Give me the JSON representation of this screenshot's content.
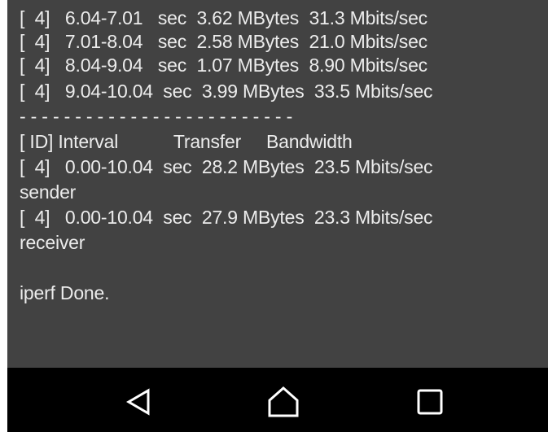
{
  "terminal": {
    "lines": [
      "[  4]   6.04-7.01   sec  3.62 MBytes  31.3 Mbits/sec",
      "[  4]   7.01-8.04   sec  2.58 MBytes  21.0 Mbits/sec",
      "[  4]   8.04-9.04   sec  1.07 MBytes  8.90 Mbits/sec",
      "[  4]   9.04-10.04  sec  3.99 MBytes  33.5 Mbits/sec",
      "- - - - - - - - - - - - - - - - - - - - - - - - -",
      "[ ID] Interval           Transfer     Bandwidth",
      "[  4]   0.00-10.04  sec  28.2 MBytes  23.5 Mbits/sec",
      "sender",
      "[  4]   0.00-10.04  sec  27.9 MBytes  23.3 Mbits/sec",
      "receiver",
      "",
      "iperf Done."
    ]
  },
  "navbar": {
    "back_icon": "back-triangle-icon",
    "home_icon": "home-icon",
    "recents_icon": "recents-square-icon"
  },
  "colors": {
    "terminal_bg": "#424242",
    "terminal_text": "#ececec",
    "navbar_bg": "#000000",
    "nav_icon": "#ffffff"
  }
}
